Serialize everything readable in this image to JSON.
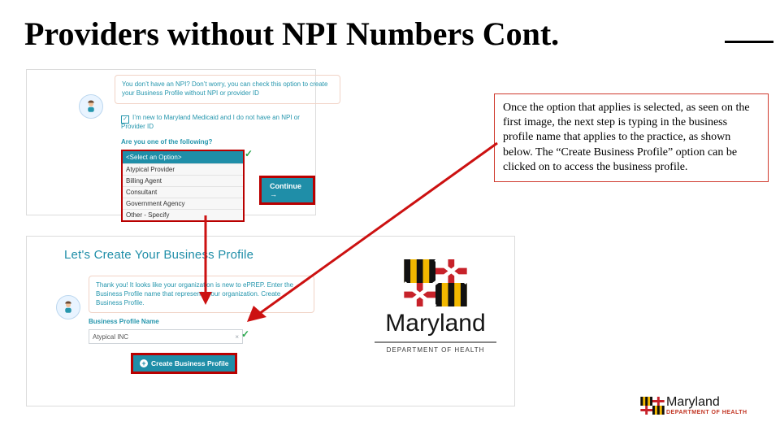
{
  "title": "Providers without NPI Numbers Cont.",
  "note": "Once the option that applies is selected, as seen on the first image, the next step is typing in the business profile name that applies to the practice, as shown below. The “Create Business Profile” option can be clicked on to access the business profile.",
  "panel1": {
    "intro": "You don’t have an NPI? Don’t worry, you can check this option to create your Business Profile without NPI or provider ID",
    "checkbox_mark": "✓",
    "checkbox_label": "I’m new to Maryland Medicaid and I do not have an NPI or Provider ID",
    "question": "Are you one of the following?",
    "select_header": "<Select an Option>",
    "options": [
      "Atypical Provider",
      "Billing Agent",
      "Consultant",
      "Government Agency",
      "Other - Specify"
    ],
    "continue_label": "Continue →"
  },
  "panel2": {
    "header": "Let's Create Your Business Profile",
    "intro": "Thank you! It looks like your organization is new to ePREP. Enter the Business Profile name that represents your organization. Create Business Profile.",
    "bp_label": "Business Profile Name",
    "bp_value": "Atypical INC",
    "clear_x": "×",
    "create_label": "Create Business Profile"
  },
  "md": {
    "word": "Maryland",
    "dept": "DEPARTMENT OF HEALTH"
  },
  "footer": {
    "word": "Maryland",
    "dept": "DEPARTMENT OF HEALTH"
  },
  "check": "✓"
}
